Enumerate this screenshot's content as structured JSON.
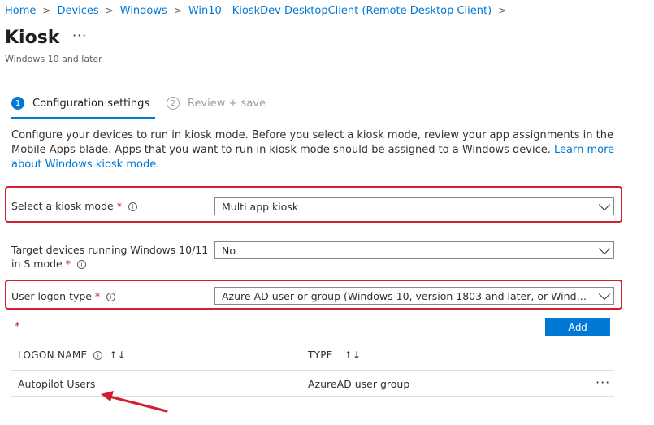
{
  "breadcrumb": [
    "Home",
    "Devices",
    "Windows",
    "Win10 - KioskDev DesktopClient (Remote Desktop Client)"
  ],
  "breadcrumb_separator": ">",
  "page": {
    "title": "Kiosk",
    "more_label": "···",
    "subtitle": "Windows 10 and later"
  },
  "wizard": {
    "steps": [
      {
        "number": "1",
        "label": "Configuration settings",
        "active": true
      },
      {
        "number": "2",
        "label": "Review + save",
        "active": false
      }
    ]
  },
  "description": {
    "text": "Configure your devices to run in kiosk mode. Before you select a kiosk mode, review your app assignments in the Mobile Apps blade. Apps that you want to run in kiosk mode should be assigned to a Windows device. ",
    "link": "Learn more about Windows kiosk mode",
    "end": "."
  },
  "fields": {
    "kiosk_mode": {
      "label": "Select a kiosk mode",
      "required": "*",
      "value": "Multi app kiosk"
    },
    "s_mode": {
      "label_line1": "Target devices running Windows 10/11",
      "label_line2": "in S mode",
      "required": "*",
      "value": "No"
    },
    "logon_type": {
      "label": "User logon type",
      "required": "*",
      "value": "Azure AD user or group (Windows 10, version 1803 and later, or Windows ..."
    }
  },
  "assign": {
    "required_marker": "*",
    "add_label": "Add"
  },
  "table": {
    "columns": [
      {
        "label": "LOGON NAME",
        "info": true,
        "sort": "↑↓"
      },
      {
        "label": "TYPE",
        "info": false,
        "sort": "↑↓"
      }
    ],
    "rows": [
      {
        "name": "Autopilot Users",
        "type": "AzureAD user group",
        "more": "···"
      }
    ]
  },
  "icons": {
    "info": "info-icon",
    "chevron": "chevron-down-icon",
    "sort": "sort-icon",
    "annotation": "red-arrow-annotation"
  },
  "colors": {
    "accent": "#0078d4",
    "highlight": "#d1202f",
    "required": "#a4262c"
  }
}
